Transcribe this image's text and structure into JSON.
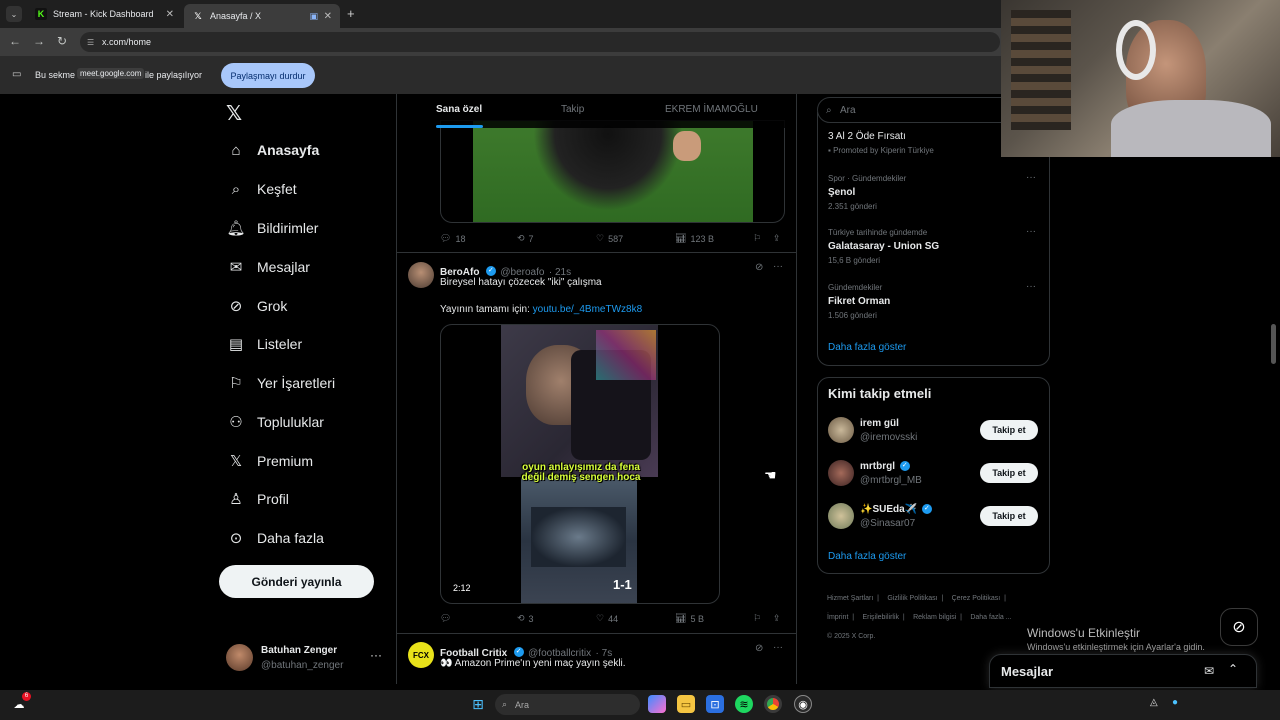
{
  "browser": {
    "tabs": [
      {
        "title": "Stream - Kick Dashboard",
        "icon": "kick-icon"
      },
      {
        "title": "Anasayfa / X",
        "icon": "x-logo-icon"
      }
    ],
    "url": "x.com/home",
    "share_bar": {
      "prefix": "Bu sekme",
      "host": "meet.google.com",
      "suffix": "ile paylaşılıyor",
      "stop_button": "Paylaşmayı durdur"
    }
  },
  "sidebar": {
    "items": [
      {
        "label": "Anasayfa",
        "icon": "home-icon"
      },
      {
        "label": "Keşfet",
        "icon": "search-icon"
      },
      {
        "label": "Bildirimler",
        "icon": "bell-icon"
      },
      {
        "label": "Mesajlar",
        "icon": "mail-icon"
      },
      {
        "label": "Grok",
        "icon": "grok-icon"
      },
      {
        "label": "Listeler",
        "icon": "list-icon"
      },
      {
        "label": "Yer İşaretleri",
        "icon": "bookmark-icon"
      },
      {
        "label": "Topluluklar",
        "icon": "communities-icon"
      },
      {
        "label": "Premium",
        "icon": "x-logo-icon"
      },
      {
        "label": "Profil",
        "icon": "person-icon"
      },
      {
        "label": "Daha fazla",
        "icon": "more-circle-icon"
      }
    ],
    "post_button": "Gönderi yayınla",
    "account": {
      "name": "Batuhan Zenger",
      "handle": "@batuhan_zenger"
    }
  },
  "feed": {
    "tabs": [
      "Sana özel",
      "Takip",
      "EKREM İMAMOĞLU"
    ],
    "first_tweet_actions": {
      "replies": "18",
      "retweets": "7",
      "likes": "587",
      "views": "123 B"
    },
    "tweet2": {
      "name": "BeroAfo",
      "handle": "@beroafo",
      "time": "· 21s",
      "text": "Bireysel hatayı çözecek \"iki\" çalışma",
      "link_prefix": "Yayının tamamı için:",
      "link": "youtu.be/_4BmeTWz8k8",
      "video_caption": "oyun anlayışımız da fena değil demiş sengen hoca",
      "video_duration": "2:12",
      "score": "1-1",
      "actions": {
        "replies": "",
        "retweets": "3",
        "likes": "44",
        "views": "5 B"
      }
    },
    "tweet3": {
      "name": "Football Critix",
      "handle": "@footballcritix",
      "time": "· 7s",
      "text": "👀 Amazon Prime'ın yeni maç yayın şekli.",
      "avatar_text": "FCX"
    }
  },
  "right": {
    "search_placeholder": "Ara",
    "promo": {
      "title": "3 Al 2 Öde Fırsatı",
      "promoted": "Promoted by Kiperin Türkiye"
    },
    "trends": [
      {
        "meta": "Spor · Gündemdekiler",
        "title": "Şenol",
        "count": "2.351 gönderi"
      },
      {
        "meta": "Türkiye tarihinde gündemde",
        "title": "Galatasaray - Union SG",
        "count": "15,6 B gönderi"
      },
      {
        "meta": "Gündemdekiler",
        "title": "Fikret Orman",
        "count": "1.506 gönderi"
      }
    ],
    "show_more": "Daha fazla göster",
    "who_to_follow": {
      "title": "Kimi takip etmeli",
      "users": [
        {
          "name": "irem gül",
          "handle": "@iremovsski",
          "verified": false
        },
        {
          "name": "mrtbrgl",
          "handle": "@mrtbrgl_MB",
          "verified": true
        },
        {
          "name": "✨SUEda✈️",
          "handle": "@Sinasar07",
          "verified": true
        }
      ],
      "follow_label": "Takip et",
      "show_more": "Daha fazla göster"
    },
    "footer": {
      "links": [
        "Hizmet Şartları",
        "Gizlilik Politikası",
        "Çerez Politikası",
        "İmprint",
        "Erişilebilirlik",
        "Reklam bilgisi",
        "Daha fazla ..."
      ],
      "copyright": "© 2025 X Corp."
    }
  },
  "overlay": {
    "windows_activate_title": "Windows'u Etkinleştir",
    "windows_activate_sub": "Windows'u etkinleştirmek için Ayarlar'a gidin.",
    "messages_dock": "Mesajlar"
  },
  "taskbar": {
    "search_placeholder": "Ara",
    "weather_badge": "6"
  }
}
